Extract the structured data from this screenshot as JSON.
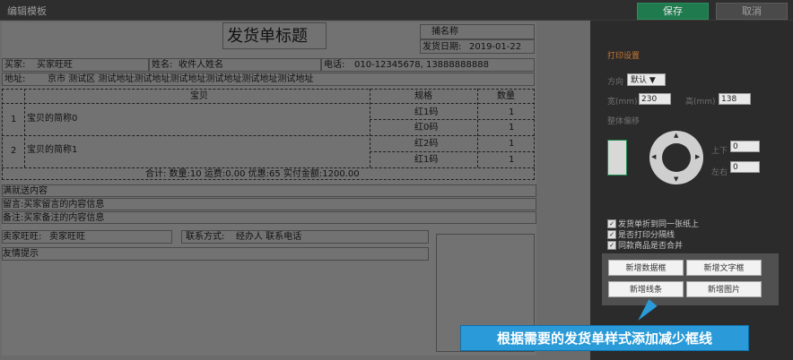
{
  "window": {
    "title": "编辑模板"
  },
  "toolbar": {
    "save_label": "保存",
    "cancel_label": "取消"
  },
  "template": {
    "title": "发货单标题",
    "shop_name": "捕名称",
    "ship_date_label": "发货日期:",
    "ship_date": "2019-01-22",
    "buyer_label": "买家:",
    "buyer_value": "买家旺旺",
    "recipient_label": "姓名:",
    "recipient_value": "收件人姓名",
    "phone_label": "电话:",
    "phone_value": "010-12345678, 13888888888",
    "address_label": "地址:",
    "address_value": "京市 测试区 测试地址测试地址测试地址测试地址测试地址测试地址",
    "col_item": "宝贝",
    "col_spec": "规格",
    "col_qty": "数量",
    "rows": [
      {
        "no": "1",
        "name": "宝贝的简称0",
        "specs": [
          "红1码",
          "红0码"
        ],
        "qtys": [
          "1",
          "1"
        ]
      },
      {
        "no": "2",
        "name": "宝贝的简称1",
        "specs": [
          "红2码",
          "红1码"
        ],
        "qtys": [
          "1",
          "1"
        ]
      }
    ],
    "summary": "合计: 数量:10 运费:0.00 优惠:65 实付金额:1200.00",
    "notes": [
      "满就送内容",
      "留言:买家留言的内容信息",
      "备注:买家备注的内容信息"
    ],
    "seller_label": "卖家旺旺:",
    "seller_value": "卖家旺旺",
    "contact_label": "联系方式:",
    "contact_value": "经办人 联系电话",
    "tip": "友情提示"
  },
  "sidebar": {
    "section_title": "打印设置",
    "direction_label": "方向",
    "direction_value": "默认 ▼",
    "width_label": "宽(mm)",
    "width_value": "230",
    "height_label": "高(mm)",
    "height_value": "138",
    "offset_label": "整体偏移",
    "updown_label": "上下",
    "updown_value": "0",
    "leftright_label": "左右",
    "leftright_value": "0",
    "checkboxes": [
      {
        "label": "发货单折到同一张纸上",
        "checked": true
      },
      {
        "label": "是否打印分隔线",
        "checked": true
      },
      {
        "label": "同款商品是否合并",
        "checked": true
      }
    ],
    "add_data_box": "新增数据框",
    "add_text_box": "新增文字框",
    "add_line": "新增线条",
    "add_image": "新增图片"
  },
  "callout": "根据需要的发货单样式添加减少框线",
  "colors": {
    "accent_green": "#1f7a4e",
    "callout_blue": "#2a9bd8",
    "section_orange": "#c87830"
  }
}
